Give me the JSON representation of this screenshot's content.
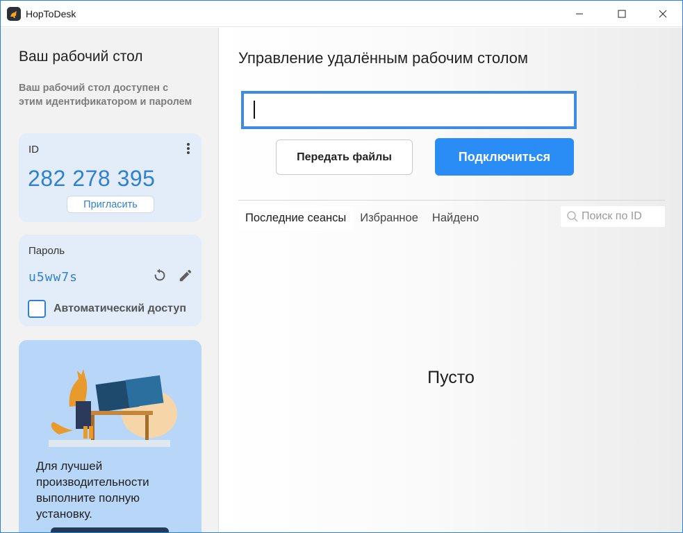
{
  "window": {
    "title": "HopToDesk",
    "icon": "kangaroo-logo-icon",
    "controls": [
      "minimize-icon",
      "maximize-icon",
      "close-icon"
    ]
  },
  "sidebar": {
    "title": "Ваш рабочий стол",
    "description": "Ваш рабочий стол доступен с этим идентификатором и паролем",
    "id_card": {
      "label": "ID",
      "value": "282 278 395",
      "invite_label": "Пригласить",
      "menu_icon": "more-vertical-icon"
    },
    "password_card": {
      "label": "Пароль",
      "value": "u5ww7s",
      "refresh_icon": "refresh-icon",
      "edit_icon": "pencil-icon",
      "auto_access_label": "Автоматический доступ",
      "auto_access_checked": false
    },
    "promo": {
      "text": "Для лучшей производительности выполните полную установку."
    }
  },
  "main": {
    "title": "Управление удалённым рабочим столом",
    "remote_id_value": "",
    "transfer_files_label": "Передать файлы",
    "connect_label": "Подключиться",
    "tabs": [
      {
        "label": "Последние сеансы",
        "active": true
      },
      {
        "label": "Избранное",
        "active": false
      },
      {
        "label": "Найдено",
        "active": false
      }
    ],
    "search_placeholder": "Поиск по ID",
    "empty_text": "Пусто"
  },
  "colors": {
    "accent": "#2a8cf5",
    "id_text": "#2f80d1",
    "card_bg": "#e3edfa",
    "promo_bg": "#b7d6f8"
  }
}
